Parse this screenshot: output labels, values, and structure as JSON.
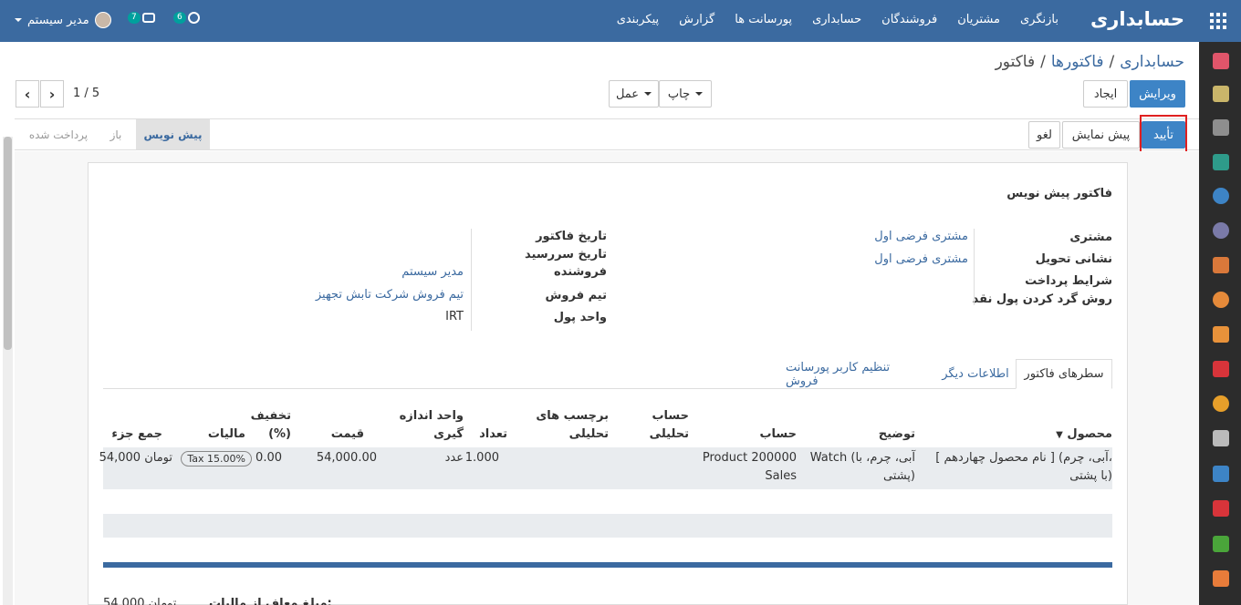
{
  "navbar": {
    "brand": "حسابداری",
    "menu": [
      "بازنگری",
      "مشتریان",
      "فروشندگان",
      "حسابداری",
      "پورسانت ها",
      "گزارش",
      "پیکربندی"
    ],
    "user_name": "مدیر سیستم",
    "messages_count": "7",
    "activities_count": "6"
  },
  "breadcrumb": {
    "root": "حسابداری",
    "parent": "فاکتورها",
    "current": "فاکتور",
    "separator": "/"
  },
  "toolbar": {
    "edit_label": "ویرایش",
    "create_label": "ایجاد",
    "print_label": "چاپ",
    "action_label": "عمل",
    "pager": "1 / 5"
  },
  "header_buttons": {
    "confirm_label": "تأیید",
    "preview_label": "پیش نمایش",
    "cancel_label": "لغو"
  },
  "status_stages": [
    "پیش نویس",
    "باز",
    "پرداخت شده"
  ],
  "form": {
    "title": "فاکتور پیش نویس",
    "right_labels": {
      "customer": "مشتری",
      "delivery_address": "نشانی تحویل",
      "payment_terms": "شرایط پرداخت",
      "rounding": "روش گرد کردن پول نقد"
    },
    "right_values": {
      "customer": "مشتری فرضی اول",
      "delivery_address": "مشتری فرضی اول"
    },
    "left_labels": {
      "invoice_date": "تاریخ فاکتور",
      "due_date": "تاریخ سررسید",
      "salesperson": "فروشنده",
      "sales_team": "تیم فروش",
      "currency": "واحد پول"
    },
    "left_values": {
      "salesperson": "مدیر سیستم",
      "sales_team": "تیم فروش شرکت تابش تجهیز",
      "currency": "IRT"
    }
  },
  "tabs": [
    "سطرهای فاکتور",
    "اطلاعات دیگر",
    "تنظیم کاربر پورسانت فروش"
  ],
  "table": {
    "headers": {
      "product": "محصول",
      "description": "توضیح",
      "account": "حساب",
      "analytic_account_1": "حساب",
      "analytic_account_2": "تحلیلی",
      "analytic_tags_1": "برچسب های",
      "analytic_tags_2": "تحلیلی",
      "quantity": "تعداد",
      "uom_1": "واحد اندازه",
      "uom_2": "گیری",
      "price": "قیمت",
      "discount_1": "تخفیف",
      "discount_2": "(%)",
      "taxes": "مالیات",
      "subtotal": "جمع جزء"
    },
    "row": {
      "product_1": "[ نام محصول چهاردهم ] (آبی، چرم،",
      "product_2": "با پشتی)",
      "description_1": "Watch (آبی، چرم، با",
      "description_2": "پشتی)",
      "account_1": "Product 200000",
      "account_2": "Sales",
      "quantity": "1.000",
      "uom": "عدد",
      "price": "54,000.00",
      "discount": "0.00",
      "tax": "Tax 15.00%",
      "subtotal": "54,000 تومان"
    }
  },
  "totals": {
    "untaxed_label": "مبلغ معاف از مالیات:",
    "untaxed_value": "54,000 تومان"
  },
  "colors": {
    "navbar": "#3b6aa0",
    "primary": "#3d84c6",
    "sidebar": "#2c2c2c",
    "highlight": "#e02020"
  }
}
